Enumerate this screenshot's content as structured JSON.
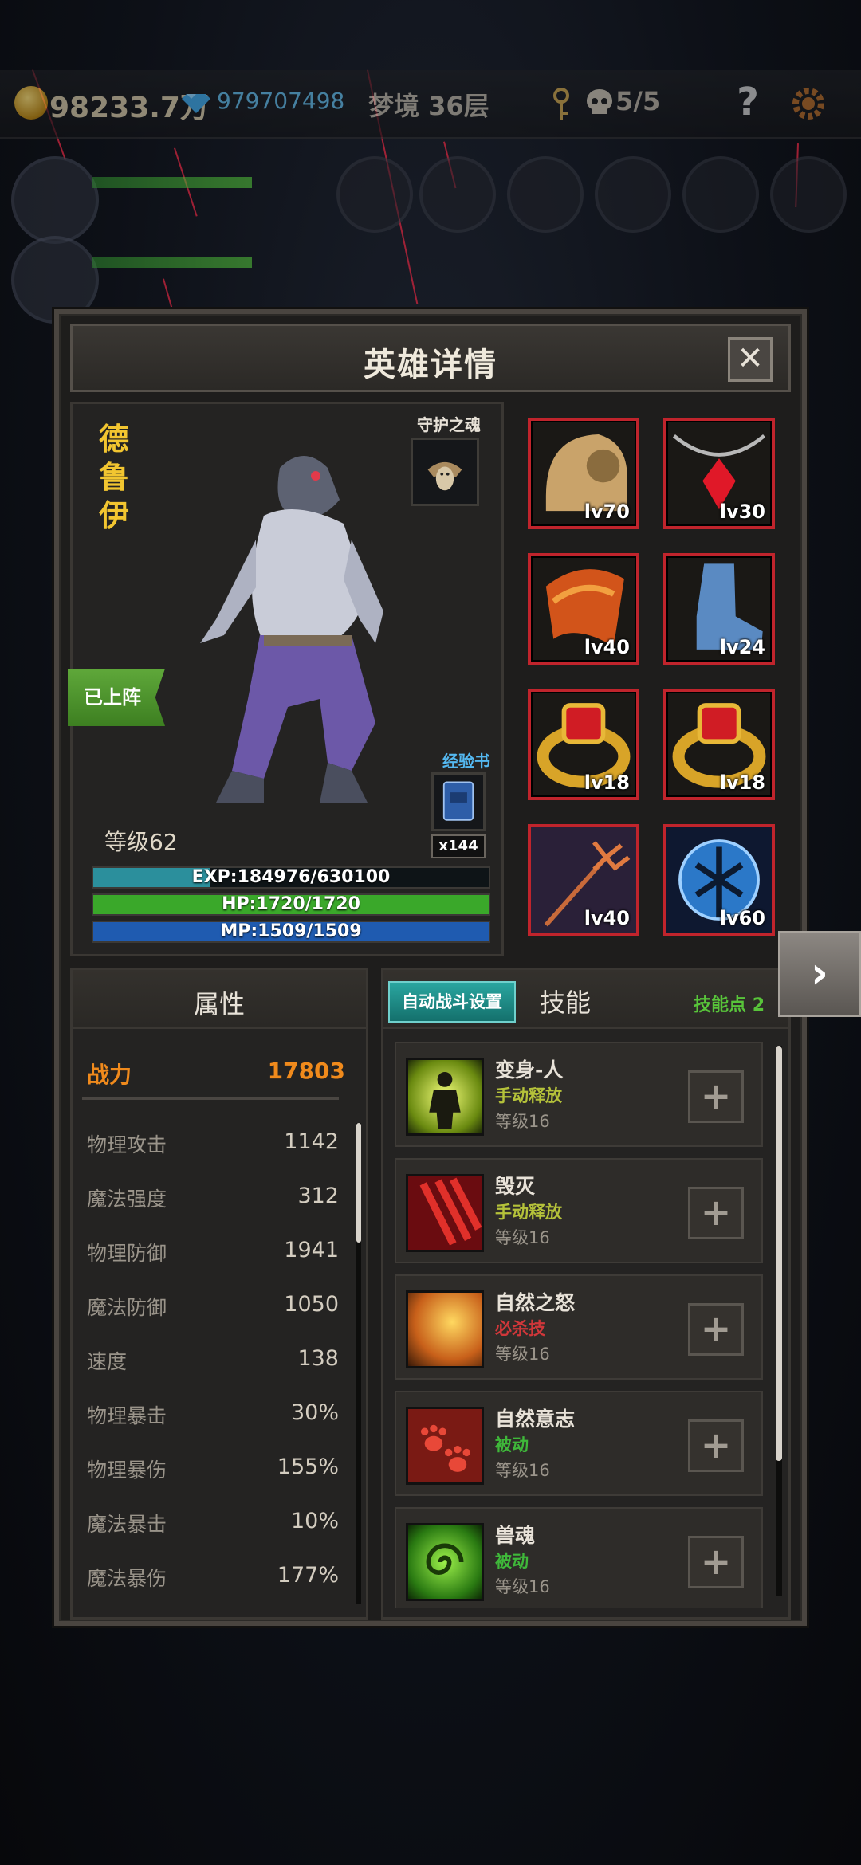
{
  "topbar": {
    "gold": "98233.7万",
    "gems": "979707498",
    "dream_floor": "梦境 36层",
    "skull_count": "5/5",
    "help": "?"
  },
  "panel": {
    "title": "英雄详情",
    "close": "✕"
  },
  "hero": {
    "name_chars": [
      "德",
      "鲁",
      "伊"
    ],
    "guardian_label": "守护之魂",
    "deployed": "已上阵",
    "exp_book_label": "经验书",
    "exp_book_count": "x144",
    "level": "等级62",
    "bars": [
      {
        "text": "EXP:184976/630100",
        "fill": 0.2936,
        "color": "#2b8f9c"
      },
      {
        "text": "HP:1720/1720",
        "fill": 1.0,
        "color": "#3aa82a"
      },
      {
        "text": "MP:1509/1509",
        "fill": 1.0,
        "color": "#1f5bb0"
      }
    ]
  },
  "equipment": [
    {
      "level": "lv70",
      "icon": "helmet-icon"
    },
    {
      "level": "lv30",
      "icon": "necklace-icon"
    },
    {
      "level": "lv40",
      "icon": "cloak-icon"
    },
    {
      "level": "lv24",
      "icon": "boots-icon"
    },
    {
      "level": "lv18",
      "icon": "ring-icon"
    },
    {
      "level": "lv18",
      "icon": "ring-icon"
    },
    {
      "level": "lv40",
      "icon": "trident-icon"
    },
    {
      "level": "lv60",
      "icon": "shield-icon"
    }
  ],
  "attributes": {
    "title": "属性",
    "power_label": "战力",
    "power_value": "17803",
    "rows": [
      {
        "name": "物理攻击",
        "value": "1142"
      },
      {
        "name": "魔法强度",
        "value": "312"
      },
      {
        "name": "物理防御",
        "value": "1941"
      },
      {
        "name": "魔法防御",
        "value": "1050"
      },
      {
        "name": "速度",
        "value": "138"
      },
      {
        "name": "物理暴击",
        "value": "30%"
      },
      {
        "name": "物理暴伤",
        "value": "155%"
      },
      {
        "name": "魔法暴击",
        "value": "10%"
      },
      {
        "name": "魔法暴伤",
        "value": "177%"
      }
    ]
  },
  "skills": {
    "auto_battle": "自动战斗设置",
    "tab": "技能",
    "points": "技能点 2",
    "add": "+",
    "list": [
      {
        "name": "变身-人",
        "type": "手动释放",
        "type_color": "#b5c23a",
        "level": "等级16",
        "icon": "transform-icon"
      },
      {
        "name": "毁灭",
        "type": "手动释放",
        "type_color": "#b5c23a",
        "level": "等级16",
        "icon": "claw-slash-icon"
      },
      {
        "name": "自然之怒",
        "type": "必杀技",
        "type_color": "#d0373a",
        "level": "等级16",
        "icon": "nature-wrath-icon"
      },
      {
        "name": "自然意志",
        "type": "被动",
        "type_color": "#3fb83a",
        "level": "等级16",
        "icon": "paw-print-icon"
      },
      {
        "name": "兽魂",
        "type": "被动",
        "type_color": "#3fb83a",
        "level": "等级16",
        "icon": "beast-soul-icon"
      }
    ]
  }
}
